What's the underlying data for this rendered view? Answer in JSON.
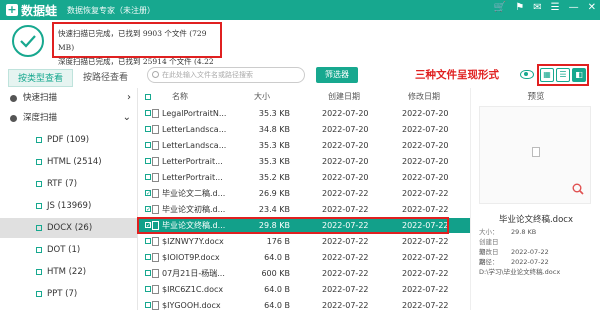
{
  "app": {
    "name": "数据蛙",
    "subtitle": "数据恢复专家（未注册）"
  },
  "window_controls": [
    "🛒",
    "⚑",
    "✉",
    "☰",
    "—",
    "✕"
  ],
  "status": {
    "quick_scan": "快速扫描已完成，已找到 9903 个文件 (729 MB)",
    "deep_scan": "深度扫描已完成，已找到 25914 个文件 (4.22 GB)"
  },
  "tabs": [
    "按类型查看",
    "按路径查看"
  ],
  "search": {
    "placeholder": "在此处输入文件名或路径搜索"
  },
  "filter_button": "筛选器",
  "annotation": "三种文件呈现形式",
  "view_modes": [
    "grid",
    "list",
    "detail"
  ],
  "tree": {
    "quick_scan": "快速扫描",
    "deep_scan": "深度扫描",
    "children": [
      "PDF (109)",
      "HTML (2514)",
      "RTF (7)",
      "JS (13969)",
      "DOCX (26)",
      "DOT (1)",
      "HTM (22)",
      "PPT (7)"
    ],
    "active_child": "DOCX (26)"
  },
  "table": {
    "headers": {
      "name": "名称",
      "size": "大小",
      "created": "创建日期",
      "modified": "修改日期"
    },
    "rows": [
      {
        "checked": false,
        "name": "LegalPortraitN...",
        "size": "35.3 KB",
        "created": "2022-07-20",
        "modified": "2022-07-20"
      },
      {
        "checked": false,
        "name": "LetterLandsca...",
        "size": "34.8 KB",
        "created": "2022-07-20",
        "modified": "2022-07-20"
      },
      {
        "checked": false,
        "name": "LetterLandsca...",
        "size": "35.3 KB",
        "created": "2022-07-20",
        "modified": "2022-07-20"
      },
      {
        "checked": false,
        "name": "LetterPortrait...",
        "size": "35.3 KB",
        "created": "2022-07-20",
        "modified": "2022-07-20"
      },
      {
        "checked": false,
        "name": "LetterPortrait...",
        "size": "35.2 KB",
        "created": "2022-07-20",
        "modified": "2022-07-20"
      },
      {
        "checked": true,
        "name": "毕业论文二稿.d...",
        "size": "26.9 KB",
        "created": "2022-07-22",
        "modified": "2022-07-22"
      },
      {
        "checked": true,
        "name": "毕业论文初稿.d...",
        "size": "23.4 KB",
        "created": "2022-07-22",
        "modified": "2022-07-22"
      },
      {
        "checked": true,
        "name": "毕业论文终稿.d...",
        "size": "29.8 KB",
        "created": "2022-07-22",
        "modified": "2022-07-22",
        "highlighted": true
      },
      {
        "checked": false,
        "name": "$IZNWY7Y.docx",
        "size": "176 B",
        "created": "2022-07-22",
        "modified": "2022-07-22"
      },
      {
        "checked": false,
        "name": "$IOIOT9P.docx",
        "size": "64.0 B",
        "created": "2022-07-22",
        "modified": "2022-07-22"
      },
      {
        "checked": false,
        "name": "07月21日-杨瑞...",
        "size": "600 KB",
        "created": "2022-07-22",
        "modified": "2022-07-22"
      },
      {
        "checked": false,
        "name": "$IRC6Z1C.docx",
        "size": "64.0 B",
        "created": "2022-07-22",
        "modified": "2022-07-22"
      },
      {
        "checked": false,
        "name": "$IYGOOH.docx",
        "size": "64.0 B",
        "created": "2022-07-22",
        "modified": "2022-07-22"
      }
    ]
  },
  "preview": {
    "title": "预览",
    "filename": "毕业论文终稿.docx",
    "size_label": "大小：",
    "size": "29.8 KB",
    "created_label": "创建日期：",
    "created": "2022-07-22",
    "modified_label": "修改日期：",
    "modified": "2022-07-22",
    "path_label": "路径：",
    "path": "D:\\学习\\毕业论文终稿.docx"
  },
  "colors": {
    "brand": "#17a88f",
    "annotation": "#e02020",
    "row_highlight": "#12a08a"
  }
}
